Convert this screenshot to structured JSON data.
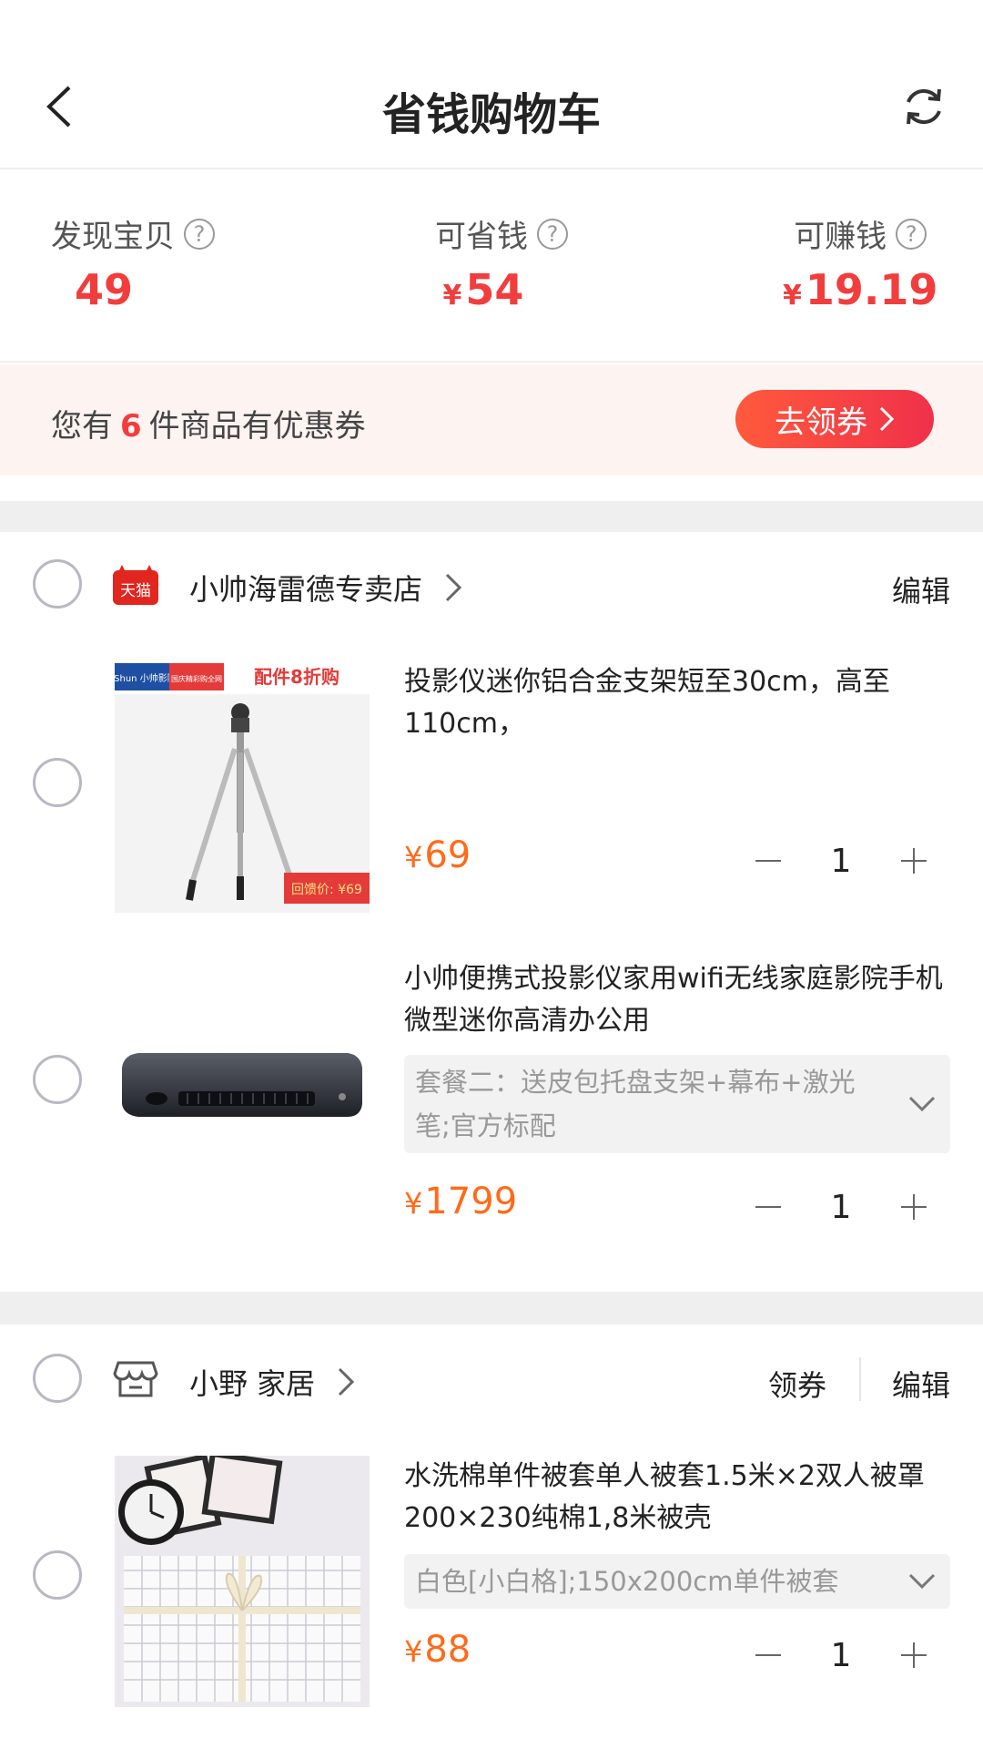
{
  "header": {
    "title": "省钱购物车"
  },
  "stats": {
    "found": {
      "label": "发现宝贝",
      "value": "49"
    },
    "save": {
      "label": "可省钱",
      "currency": "¥",
      "value": "54"
    },
    "earn": {
      "label": "可赚钱",
      "currency": "¥",
      "value": "19.19"
    },
    "help_glyph": "?"
  },
  "coupon_banner": {
    "prefix": "您有",
    "count": "6",
    "suffix": "件商品有优惠券",
    "button_label": "去领券"
  },
  "shops": [
    {
      "name": "小帅海雷德专卖店",
      "badge": "天猫",
      "edit_label": "编辑",
      "items": [
        {
          "title": "投影仪迷你铝合金支架短至30cm，高至110cm，",
          "currency": "¥",
          "price": "69",
          "quantity": "1",
          "thumb": {
            "brand": "XShun 小帅影院",
            "promo": "配件8折购",
            "tag": "国庆精彩购全网",
            "price_tag": "回馈价: ¥69"
          }
        },
        {
          "title": "小帅便携式投影仪家用wifi无线家庭影院手机微型迷你高清办公用",
          "sku": "套餐二：送皮包托盘支架+幕布+激光笔;官方标配",
          "currency": "¥",
          "price": "1799",
          "quantity": "1"
        }
      ]
    },
    {
      "name": "小野 家居",
      "coupon_label": "领券",
      "edit_label": "编辑",
      "items": [
        {
          "title": "水洗棉单件被套单人被套1.5米×2双人被罩200×230纯棉1,8米被壳",
          "sku": "白色[小白格];150x200cm单件被套",
          "currency": "¥",
          "price": "88",
          "quantity": "1"
        }
      ]
    }
  ],
  "colors": {
    "accent_red": "#f23d3d",
    "price_orange": "#ff6a1a",
    "banner_bg": "#fdf3f1",
    "separator": "#efefef"
  },
  "icons": {
    "back": "chevron-left-icon",
    "refresh": "refresh-icon",
    "shop_badge": "tmall-badge-icon",
    "store": "store-icon",
    "chevron_right": "chevron-right-icon",
    "chevron_down": "chevron-down-icon",
    "minus": "minus-icon",
    "plus": "plus-icon"
  }
}
